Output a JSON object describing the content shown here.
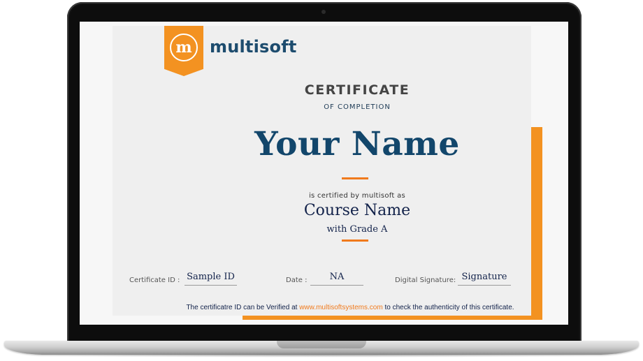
{
  "brand": {
    "logo_letter": "m",
    "name": "multisoft"
  },
  "certificate": {
    "title": "CERTIFICATE",
    "subtitle": "OF COMPLETION",
    "recipient_name": "Your Name",
    "certified_by_text": "is certified by multisoft as",
    "course_name": "Course Name",
    "grade_text": "with Grade A"
  },
  "fields": {
    "certificate_id": {
      "label": "Certificate ID :",
      "value": "Sample ID"
    },
    "date": {
      "label": "Date :",
      "value": "NA"
    },
    "signature": {
      "label": "Digital Signature:",
      "value": "Signature"
    }
  },
  "verification": {
    "prefix": "The certificatre ID can be Verified at",
    "url": "www.multisoftsystems.com",
    "suffix": "to check the authenticity of this certificate."
  },
  "colors": {
    "accent_orange": "#f39221",
    "brand_navy": "#1d4c6e",
    "name_blue": "#12466b",
    "certificate_bg": "#efefef",
    "laptop_bezel": "#0d0d0d"
  }
}
